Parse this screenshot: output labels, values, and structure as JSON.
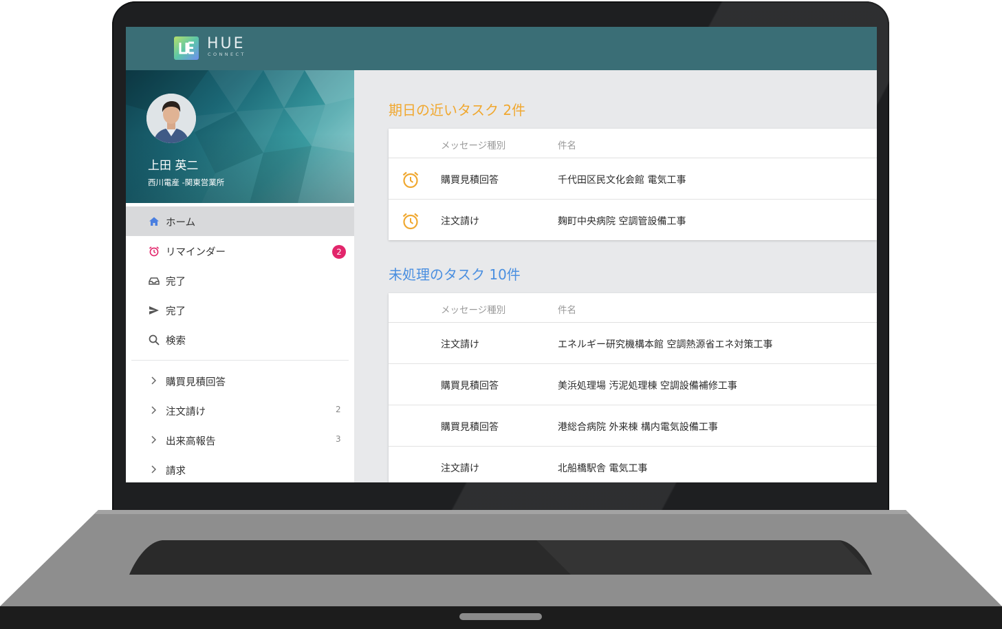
{
  "app": {
    "logo_text": "HUE",
    "logo_sub": "CONNECT"
  },
  "user": {
    "name": "上田 英二",
    "org": "西川電産 -関東営業所"
  },
  "sidebar": {
    "items": [
      {
        "label": "ホーム",
        "icon": "home-icon",
        "active": true
      },
      {
        "label": "リマインダー",
        "icon": "alarm-clock-icon",
        "badge": "2"
      },
      {
        "label": "完了",
        "icon": "inbox-tray-icon"
      },
      {
        "label": "完了",
        "icon": "send-icon"
      },
      {
        "label": "検索",
        "icon": "search-icon"
      }
    ],
    "categories": [
      {
        "label": "購買見積回答",
        "count": ""
      },
      {
        "label": "注文請け",
        "count": "2"
      },
      {
        "label": "出来高報告",
        "count": "3"
      },
      {
        "label": "請求",
        "count": ""
      }
    ]
  },
  "main": {
    "due_section": {
      "title": "期日の近いタスク 2件",
      "title_color": "#f0a830",
      "columns": [
        "メッセージ種別",
        "件名"
      ],
      "rows": [
        {
          "type": "購買見積回答",
          "subject": "千代田区民文化会館 電気工事",
          "icon": "alarm-clock-icon"
        },
        {
          "type": "注文請け",
          "subject": "麹町中央病院 空調管設備工事",
          "icon": "alarm-clock-icon"
        }
      ]
    },
    "pending_section": {
      "title": "未処理のタスク 10件",
      "title_color": "#4a8fe0",
      "columns": [
        "メッセージ種別",
        "件名"
      ],
      "rows": [
        {
          "type": "注文請け",
          "subject": "エネルギー研究機構本館 空調熱源省エネ対策工事"
        },
        {
          "type": "購買見積回答",
          "subject": "美浜処理場 汚泥処理棟 空調設備補修工事"
        },
        {
          "type": "購買見積回答",
          "subject": "港総合病院 外来棟 構内電気設備工事"
        },
        {
          "type": "注文請け",
          "subject": "北船橋駅舎 電気工事"
        }
      ]
    }
  },
  "colors": {
    "header": "#3a6e76",
    "accent_orange": "#f0a830",
    "accent_blue": "#4a8fe0",
    "badge": "#e2266b"
  }
}
